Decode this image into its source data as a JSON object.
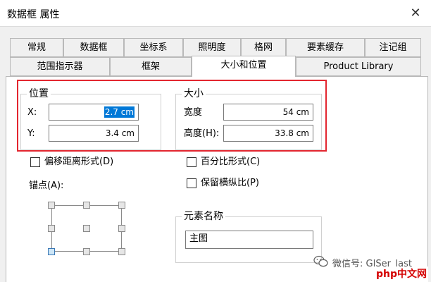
{
  "window": {
    "title": "数据框 属性",
    "close_glyph": "✕"
  },
  "tabs": {
    "row1": [
      "常规",
      "数据框",
      "坐标系",
      "照明度",
      "格网",
      "要素缓存",
      "注记组"
    ],
    "row2": [
      "范围指示器",
      "框架",
      "大小和位置",
      "Product Library"
    ],
    "active": "大小和位置"
  },
  "position_group": {
    "legend": "位置",
    "x_label": "X:",
    "x_value": "2.7 cm",
    "y_label": "Y:",
    "y_value": "3.4 cm"
  },
  "size_group": {
    "legend": "大小",
    "width_label": "宽度",
    "width_value": "54 cm",
    "height_label": "高度(H):",
    "height_value": "33.8 cm"
  },
  "options": {
    "offset_distance": "偏移距离形式(D)",
    "percent": "百分比形式(C)",
    "keep_ratio": "保留横纵比(P)",
    "anchor_label": "锚点(A):"
  },
  "element_name_group": {
    "legend": "元素名称",
    "value": "主图"
  },
  "watermark": {
    "text": "微信号: GISer_last",
    "logo": "php",
    "logo_suffix": "中文网"
  },
  "colors": {
    "selection": "#0078d7",
    "highlight": "#e3262f"
  }
}
